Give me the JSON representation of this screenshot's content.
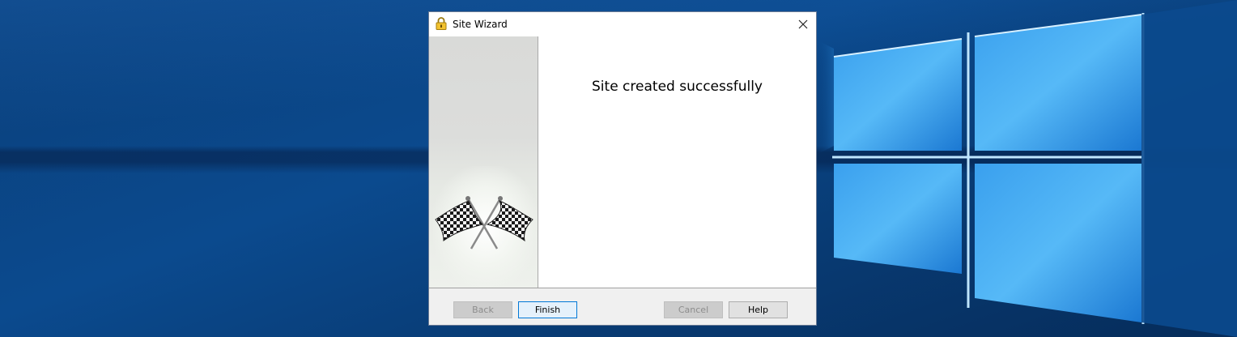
{
  "dialog": {
    "title": "Site Wizard",
    "title_icon": "padlock-icon",
    "close_icon": "close-icon",
    "side_image": "checkered-flags-icon",
    "message": "Site created successfully"
  },
  "buttons": {
    "back": "Back",
    "finish": "Finish",
    "cancel": "Cancel",
    "help": "Help"
  },
  "colors": {
    "desktop_blue": "#0b4a8e",
    "logo_light": "#4fb3f5",
    "default_button_border": "#0078d7"
  }
}
